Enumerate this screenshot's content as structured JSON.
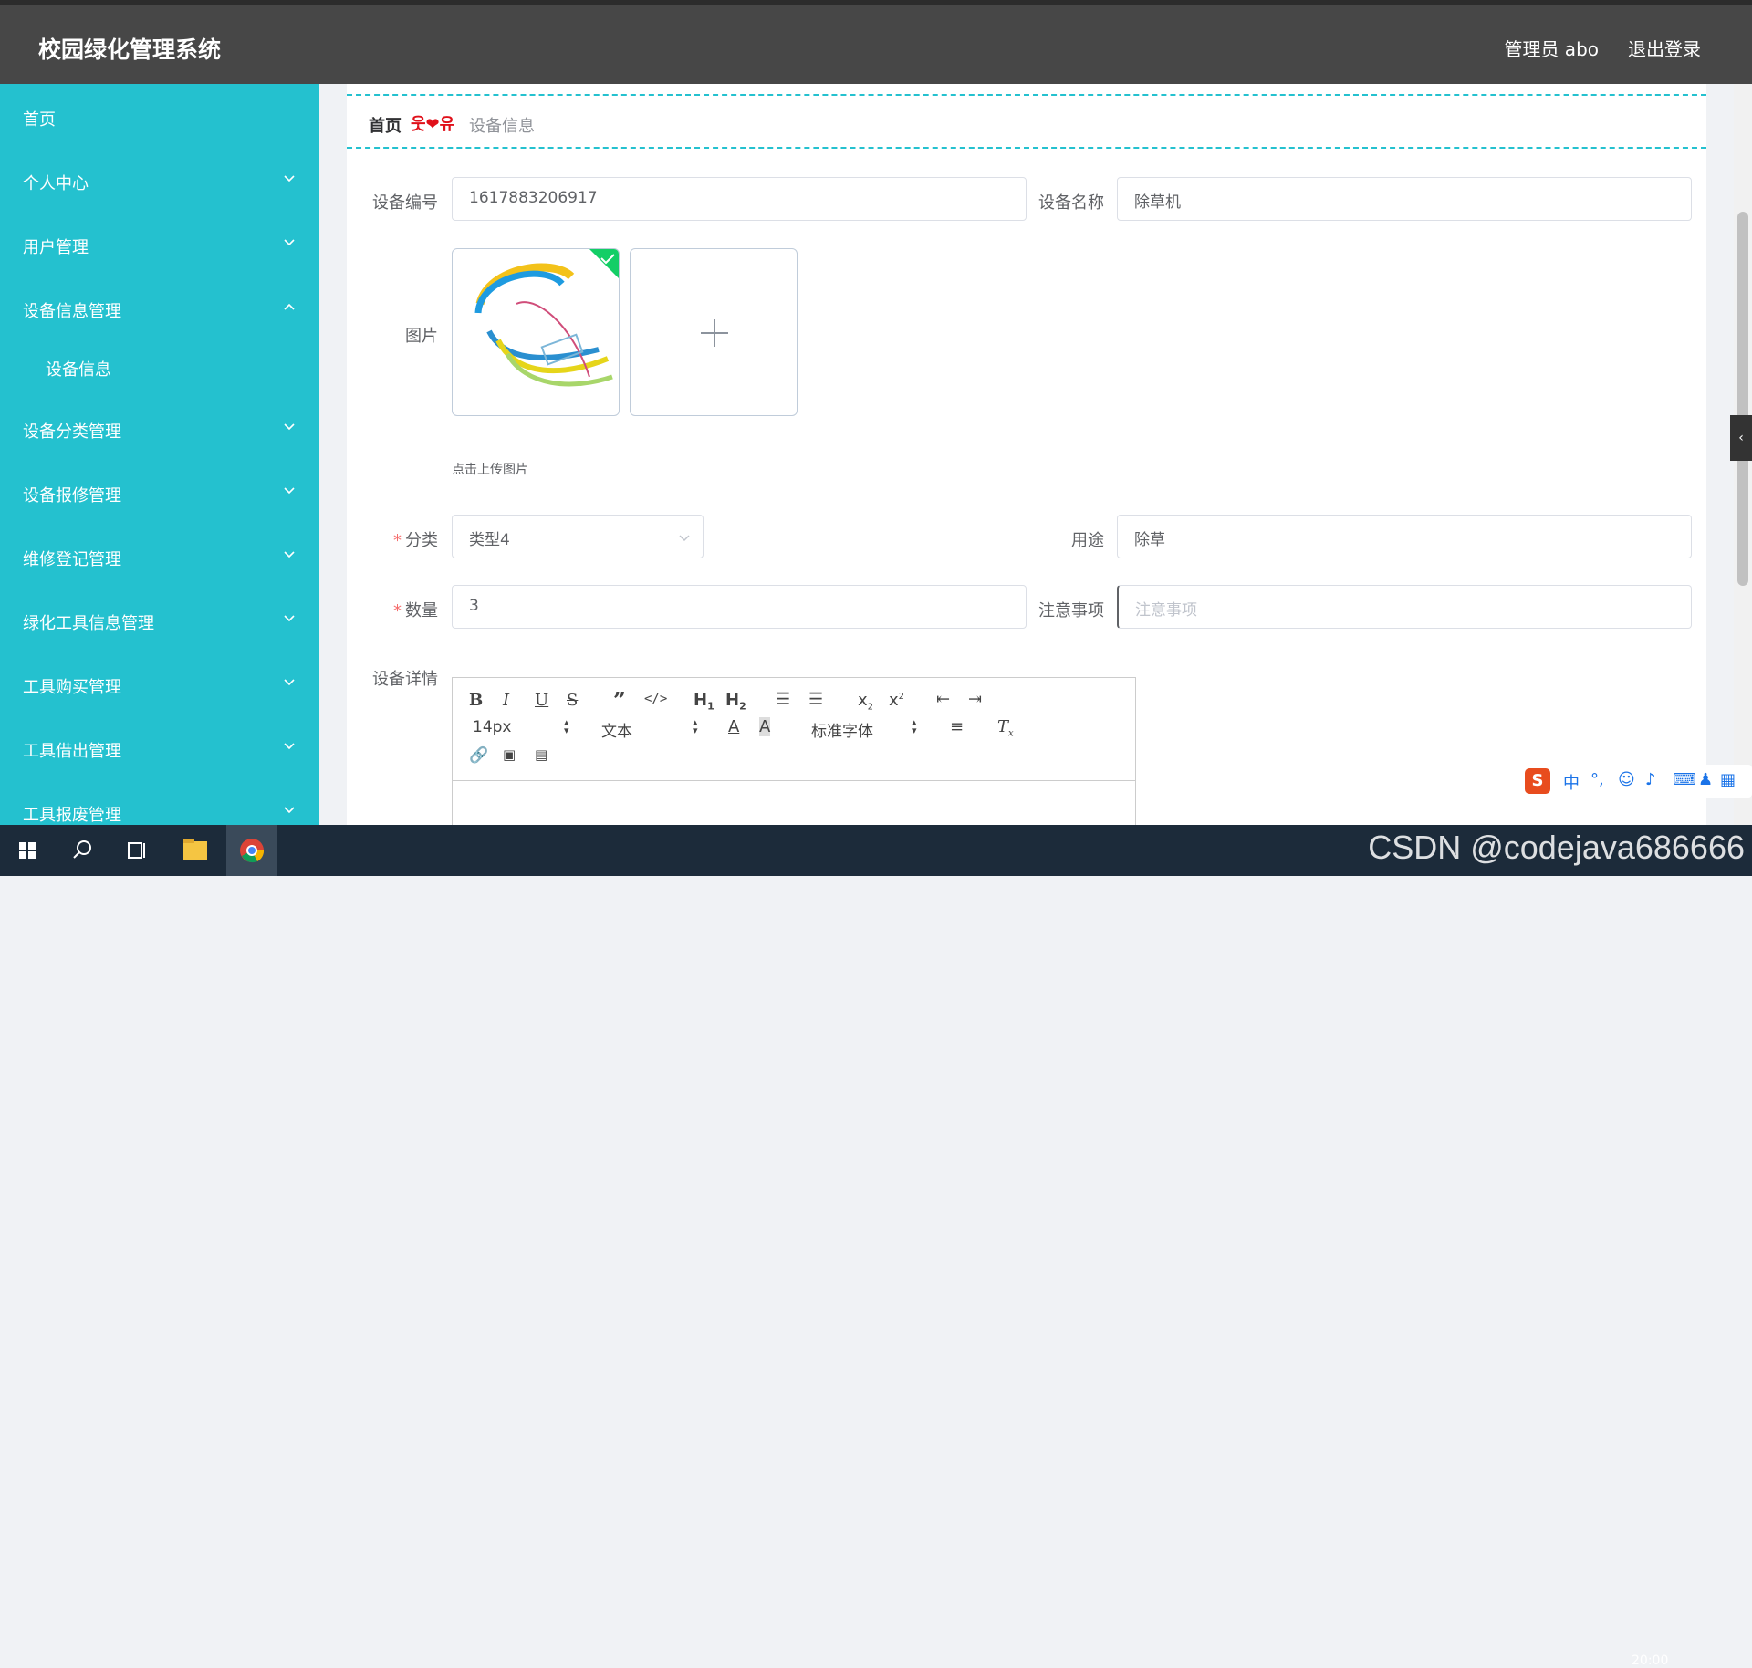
{
  "header": {
    "title": "校园绿化管理系统",
    "user": "管理员 abo",
    "logout": "退出登录"
  },
  "sidebar": {
    "items": [
      {
        "label": "首页",
        "chevron": ""
      },
      {
        "label": "个人中心",
        "chevron": "down"
      },
      {
        "label": "用户管理",
        "chevron": "down"
      },
      {
        "label": "设备信息管理",
        "chevron": "up"
      },
      {
        "label": "设备信息",
        "chevron": "",
        "sub": true
      },
      {
        "label": "设备分类管理",
        "chevron": "down"
      },
      {
        "label": "设备报修管理",
        "chevron": "down"
      },
      {
        "label": "维修登记管理",
        "chevron": "down"
      },
      {
        "label": "绿化工具信息管理",
        "chevron": "down"
      },
      {
        "label": "工具购买管理",
        "chevron": "down"
      },
      {
        "label": "工具借出管理",
        "chevron": "down"
      },
      {
        "label": "工具报废管理",
        "chevron": "down"
      }
    ]
  },
  "breadcrumb": {
    "home": "首页",
    "separator": "웃❤유",
    "current": "设备信息"
  },
  "form": {
    "device_no": {
      "label": "设备编号",
      "value": "1617883206917"
    },
    "device_name": {
      "label": "设备名称",
      "value": "除草机"
    },
    "image": {
      "label": "图片",
      "tip": "点击上传图片"
    },
    "category": {
      "label": "分类",
      "value": "类型4",
      "required": true
    },
    "usage": {
      "label": "用途",
      "value": "除草"
    },
    "quantity": {
      "label": "数量",
      "value": "3",
      "required": true
    },
    "notes": {
      "label": "注意事项",
      "value": "",
      "placeholder": "注意事项"
    },
    "details": {
      "label": "设备详情"
    }
  },
  "editor": {
    "font_size": "14px",
    "text_style": "文本",
    "font_family": "标准字体"
  },
  "taskbar": {
    "watermark": "CSDN @codejava686666",
    "clock": "20:00"
  },
  "colors": {
    "sidebar": "#24c1cf",
    "header": "#474747",
    "accent": "#24c1cf",
    "required": "#f56c6c"
  }
}
